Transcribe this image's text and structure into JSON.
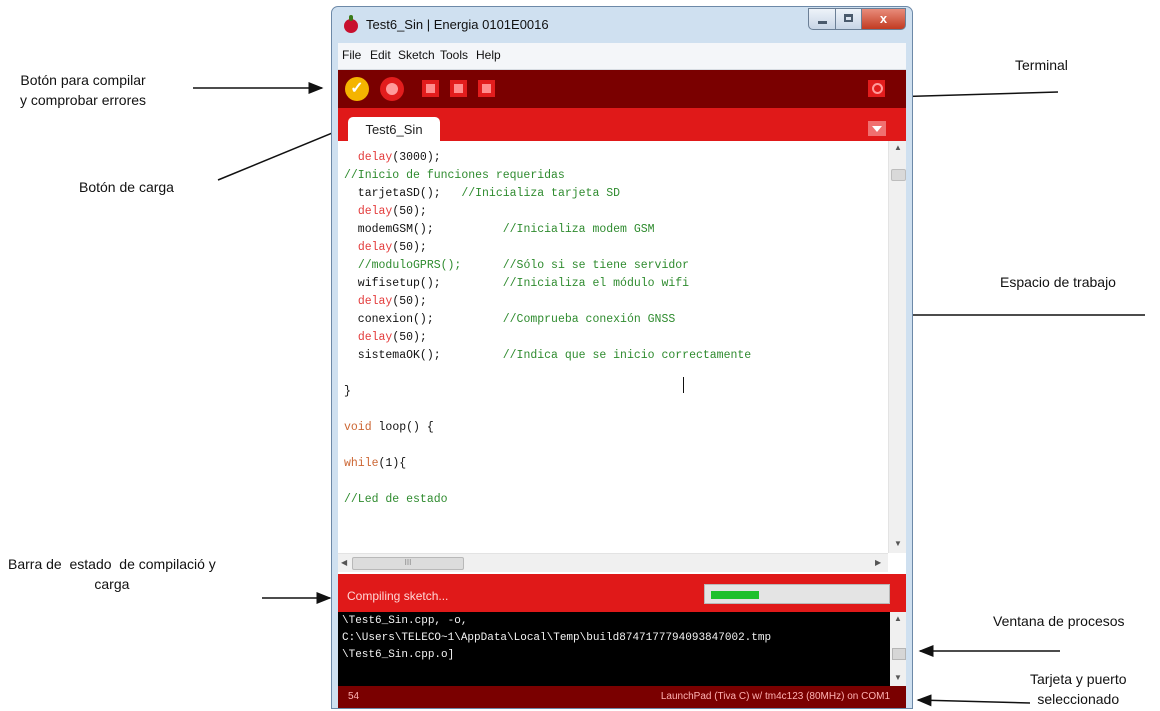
{
  "window": {
    "title": "Test6_Sin | Energia 0101E0016",
    "close_glyph": "x"
  },
  "menu": [
    "File",
    "Edit",
    "Sketch",
    "Tools",
    "Help"
  ],
  "toolbar": {
    "verify_glyph": "✓"
  },
  "tab": {
    "label": "Test6_Sin"
  },
  "editor": {
    "lines": [
      [
        "  ",
        "delay",
        "(3000);",
        "",
        ""
      ],
      [
        "",
        "",
        "",
        "//Inicio de funciones requeridas",
        ""
      ],
      [
        "  tarjetaSD();   ",
        "",
        "",
        "//Inicializa tarjeta SD",
        ""
      ],
      [
        "  ",
        "delay",
        "(50);",
        "",
        ""
      ],
      [
        "  modemGSM();          ",
        "",
        "",
        "//Inicializa modem GSM",
        ""
      ],
      [
        "  ",
        "delay",
        "(50);",
        "",
        ""
      ],
      [
        "  ",
        "",
        "",
        "//moduloGPRS();      //Sólo si se tiene servidor",
        ""
      ],
      [
        "  wifisetup();         ",
        "",
        "",
        "//Inicializa el módulo wifi",
        ""
      ],
      [
        "  ",
        "delay",
        "(50);",
        "",
        ""
      ],
      [
        "  conexion();          ",
        "",
        "",
        "//Comprueba conexión GNSS",
        ""
      ],
      [
        "  ",
        "delay",
        "(50);",
        "",
        ""
      ],
      [
        "  sistemaOK();         ",
        "",
        "",
        "//Indica que se inicio correctamente",
        ""
      ],
      [
        "",
        "",
        "",
        "",
        ""
      ],
      [
        "}",
        "",
        "",
        "",
        ""
      ],
      [
        "",
        "",
        "",
        "",
        ""
      ],
      [
        "",
        "void",
        " loop() {",
        "",
        ""
      ],
      [
        "",
        "",
        "",
        "",
        ""
      ],
      [
        "",
        "while",
        "(1){",
        "",
        ""
      ],
      [
        "",
        "",
        "",
        "",
        ""
      ],
      [
        "",
        "",
        "",
        "//Led de estado",
        ""
      ]
    ],
    "hscroll_grip": "III"
  },
  "status": {
    "text": "Compiling sketch...",
    "progress": 0.28
  },
  "console": {
    "lines": [
      "\\Test6_Sin.cpp, -o,",
      "C:\\Users\\TELECO~1\\AppData\\Local\\Temp\\build8747177794093847002.tmp",
      "\\Test6_Sin.cpp.o]"
    ]
  },
  "footer": {
    "line_number": "54",
    "board": "LaunchPad (Tiva C) w/ tm4c123 (80MHz) on COM1"
  },
  "annotations": {
    "compile": "Botón para compilar\ny comprobar errores",
    "upload": "Botón de carga",
    "terminal": "Terminal",
    "workspace": "Espacio de trabajo",
    "statusbar": "Barra de  estado  de compilació y\ncarga",
    "console": "Ventana de procesos",
    "board": "Tarjeta y puerto\nseleccionado"
  },
  "colors": {
    "toolbar": "#7a0000",
    "tabsbar": "#e01919",
    "verify_button": "#f4b400",
    "progress_fill": "#1fc02c"
  }
}
